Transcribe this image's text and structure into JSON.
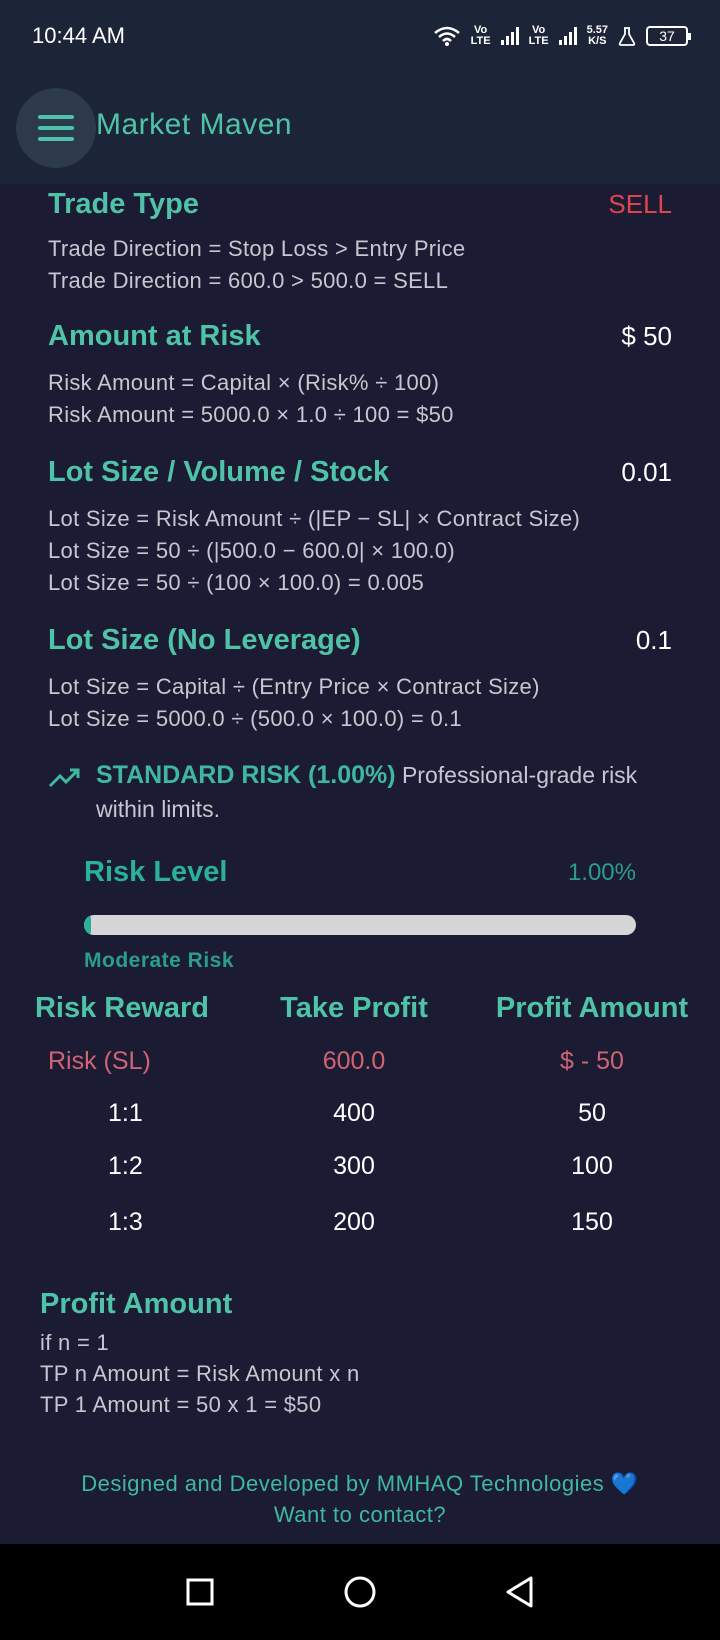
{
  "status": {
    "time": "10:44 AM",
    "net1": [
      "Vo",
      "LTE"
    ],
    "net2": [
      "Vo",
      "LTE"
    ],
    "speed": [
      "5.57",
      "K/S"
    ],
    "battery": "37"
  },
  "app": {
    "title": "Market Maven"
  },
  "trade_type": {
    "title": "Trade Type",
    "value": "SELL",
    "lines": [
      "Trade Direction = Stop Loss > Entry Price",
      "Trade Direction = 600.0 > 500.0 = SELL"
    ]
  },
  "amount_at_risk": {
    "title": "Amount at Risk",
    "value": "$ 50",
    "lines": [
      "Risk Amount = Capital × (Risk% ÷ 100)",
      "Risk Amount = 5000.0 × 1.0 ÷ 100 = $50"
    ]
  },
  "lot_size": {
    "title": "Lot Size / Volume / Stock",
    "value": "0.01",
    "lines": [
      "Lot Size = Risk Amount ÷ (|EP − SL| × Contract Size)",
      "Lot Size = 50 ÷ (|500.0 − 600.0| × 100.0)",
      "Lot Size = 50 ÷ (100 × 100.0) = 0.005"
    ]
  },
  "lot_no_leverage": {
    "title": "Lot Size (No Leverage)",
    "value": "0.1",
    "lines": [
      "Lot Size = Capital ÷ (Entry Price × Contract Size)",
      "Lot Size = 5000.0 ÷ (500.0 × 100.0) = 0.1"
    ]
  },
  "standard_risk": {
    "strong": "STANDARD RISK (1.00%)",
    "text": " Professional-grade risk within limits.",
    "icon": "trending-up-icon"
  },
  "risk_level": {
    "title": "Risk Level",
    "value": "1.00%",
    "fraction": 0.01,
    "note": "Moderate Risk"
  },
  "risk_reward": {
    "headers": [
      "Risk Reward",
      "Take Profit",
      "Profit Amount"
    ],
    "risk_row": [
      "Risk (SL)",
      "600.0",
      "$ - 50"
    ],
    "rows": [
      [
        "1:1",
        "400",
        "50"
      ],
      [
        "1:2",
        "300",
        "100"
      ],
      [
        "1:3",
        "200",
        "150"
      ]
    ]
  },
  "profit_amount": {
    "title": "Profit Amount",
    "lines": [
      "if n = 1",
      "TP n Amount = Risk Amount x n",
      "TP 1 Amount = 50 x 1 = $50"
    ]
  },
  "footer": {
    "credit": "Designed and Developed by MMHAQ Technologies",
    "heart": "💙",
    "contact": "Want to contact?"
  },
  "colors": {
    "accent": "#4fc3a8",
    "sell": "#e0454d",
    "risk_row": "#d06472",
    "background": "#1b1b34",
    "app_bar": "#1c2538"
  }
}
